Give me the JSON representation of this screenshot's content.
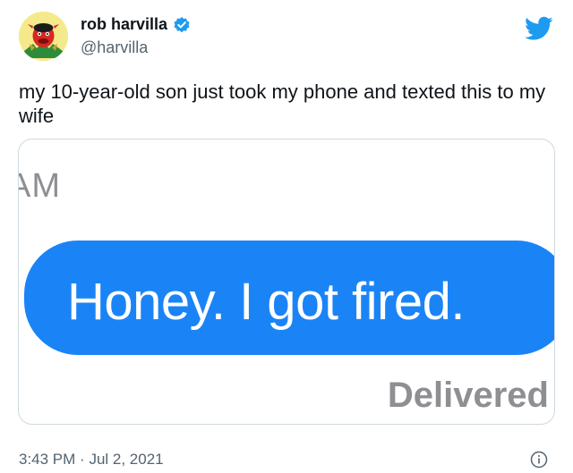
{
  "tweet": {
    "author_name": "rob harvilla",
    "handle": "@harvilla",
    "text": "my 10-year-old son just took my phone and texted this to my wife",
    "time": "3:43 PM",
    "separator": "·",
    "date": "Jul 2, 2021"
  },
  "media": {
    "time_fragment": "AM",
    "message": "Honey. I got fired.",
    "status": "Delivered"
  },
  "colors": {
    "bubble": "#1a84f7",
    "brand": "#1d9bf0",
    "secondary_text": "#536471"
  },
  "icons": {
    "verified": "verified-badge-icon",
    "brand": "bird-logo-icon",
    "info": "info-icon"
  }
}
